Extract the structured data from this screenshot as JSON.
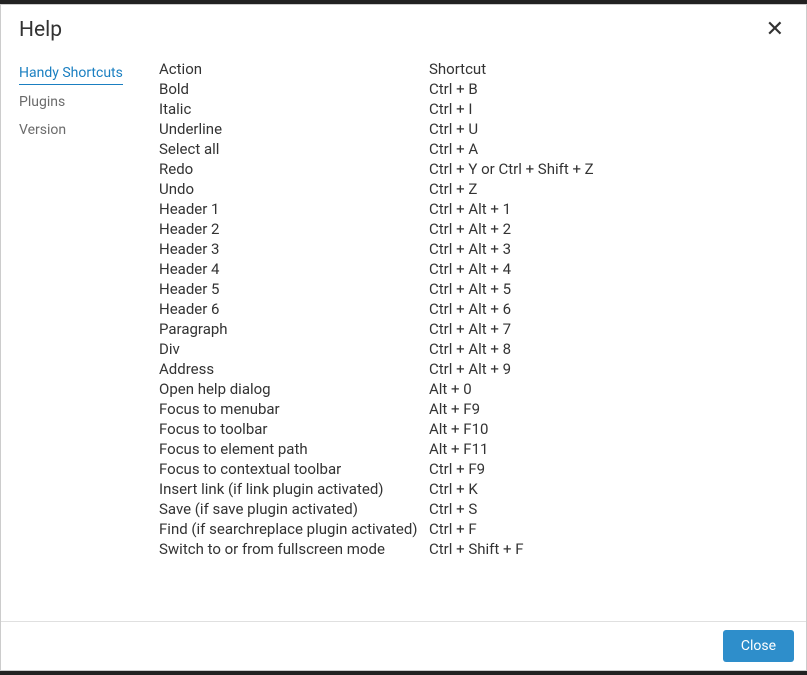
{
  "dialog": {
    "title": "Help",
    "close_symbol": "✕",
    "close_label": "Close"
  },
  "sidebar": {
    "tabs": [
      {
        "label": "Handy Shortcuts",
        "active": true
      },
      {
        "label": "Plugins",
        "active": false
      },
      {
        "label": "Version",
        "active": false
      }
    ]
  },
  "shortcuts": {
    "headers": {
      "action": "Action",
      "shortcut": "Shortcut"
    },
    "rows": [
      {
        "action": "Bold",
        "shortcut": "Ctrl + B"
      },
      {
        "action": "Italic",
        "shortcut": "Ctrl + I"
      },
      {
        "action": "Underline",
        "shortcut": "Ctrl + U"
      },
      {
        "action": "Select all",
        "shortcut": "Ctrl + A"
      },
      {
        "action": "Redo",
        "shortcut": "Ctrl + Y or Ctrl + Shift + Z"
      },
      {
        "action": "Undo",
        "shortcut": "Ctrl + Z"
      },
      {
        "action": "Header 1",
        "shortcut": "Ctrl + Alt + 1"
      },
      {
        "action": "Header 2",
        "shortcut": "Ctrl + Alt + 2"
      },
      {
        "action": "Header 3",
        "shortcut": "Ctrl + Alt + 3"
      },
      {
        "action": "Header 4",
        "shortcut": "Ctrl + Alt + 4"
      },
      {
        "action": "Header 5",
        "shortcut": "Ctrl + Alt + 5"
      },
      {
        "action": "Header 6",
        "shortcut": "Ctrl + Alt + 6"
      },
      {
        "action": "Paragraph",
        "shortcut": "Ctrl + Alt + 7"
      },
      {
        "action": "Div",
        "shortcut": "Ctrl + Alt + 8"
      },
      {
        "action": "Address",
        "shortcut": "Ctrl + Alt + 9"
      },
      {
        "action": "Open help dialog",
        "shortcut": "Alt + 0"
      },
      {
        "action": "Focus to menubar",
        "shortcut": "Alt + F9"
      },
      {
        "action": "Focus to toolbar",
        "shortcut": "Alt + F10"
      },
      {
        "action": "Focus to element path",
        "shortcut": "Alt + F11"
      },
      {
        "action": "Focus to contextual toolbar",
        "shortcut": "Ctrl + F9"
      },
      {
        "action": "Insert link (if link plugin activated)",
        "shortcut": "Ctrl + K"
      },
      {
        "action": "Save (if save plugin activated)",
        "shortcut": "Ctrl + S"
      },
      {
        "action": "Find (if searchreplace plugin activated)",
        "shortcut": "Ctrl + F"
      },
      {
        "action": "Switch to or from fullscreen mode",
        "shortcut": "Ctrl + Shift + F"
      }
    ]
  }
}
